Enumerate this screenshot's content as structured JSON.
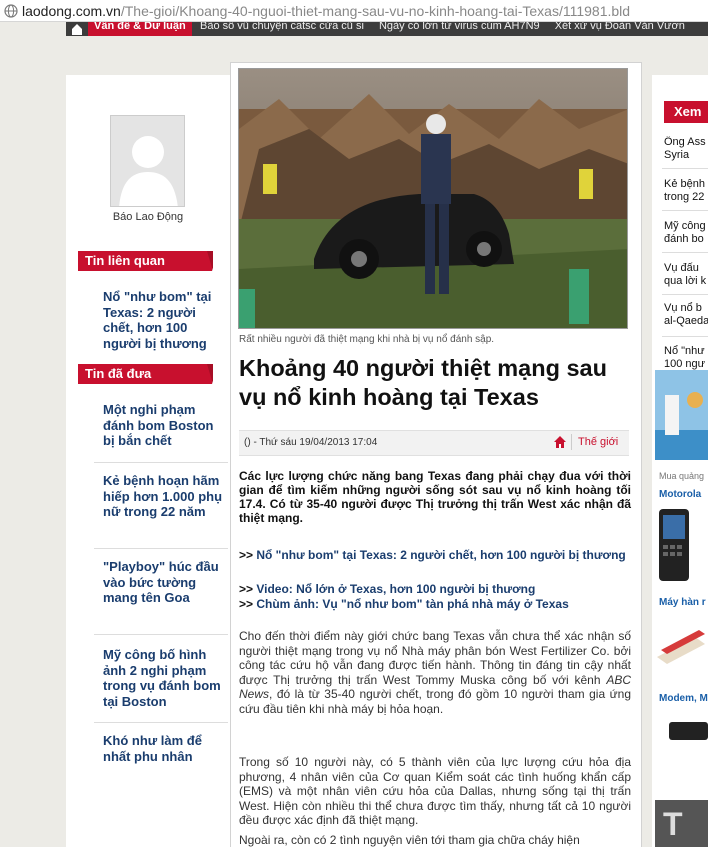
{
  "browser": {
    "url_host": "laodong.com.vn",
    "url_path": "/The-gioi/Khoang-40-nguoi-thiet-mang-sau-vu-no-kinh-hoang-tai-Texas/111981.bld"
  },
  "nav": {
    "active_label": "Vấn đề & Dư luận",
    "links": [
      "Bão số vũ chuyện catsc cửa cũ si",
      "Ngày có lớn từ virus cúm AH7N9",
      "Xét xử vụ Đoàn Văn Vươn"
    ]
  },
  "left": {
    "avatar_label": "Báo Lao Động",
    "related_heading": "Tin liên quan",
    "related": [
      "Nổ \"như bom\" tại Texas: 2 người chết, hơn 100 người bị thương"
    ],
    "posted_heading": "Tin đã đưa",
    "posted": [
      "Một nghi phạm đánh bom Boston bị bắn chết",
      "Kẻ bệnh hoạn hãm hiếp hơn 1.000 phụ nữ trong 22 năm",
      "\"Playboy\" húc đầu vào bức tường mang tên Goa",
      "Mỹ công bố hình ảnh 2 nghi phạm trong vụ đánh bom tại Boston",
      "Khó như làm để nhất phu nhân"
    ]
  },
  "article": {
    "caption": "Rất nhiều người đã thiệt mạng khi nhà bị vụ nổ đánh sập.",
    "headline": "Khoảng 40 người thiệt mạng sau vụ nổ kinh hoàng tại Texas",
    "meta_date": "() - Thứ sáu 19/04/2013 17:04",
    "category": "Thế giới",
    "lead": "Các lực lượng chức năng bang Texas đang phải chạy đua với thời gian để tìm kiếm những người sống sót sau vụ nổ kinh hoàng tối 17.4. Có từ 35-40 người được Thị trưởng thị trấn West xác nhận đã thiệt mạng.",
    "related": [
      {
        "prefix": ">>",
        "text": " Nổ \"như bom\" tại Texas: 2 người chết, hơn 100 người bị thương"
      },
      {
        "prefix": ">>",
        "text": " Video: Nổ lớn ở Texas, hơn 100 người bị thương"
      },
      {
        "prefix": ">>",
        "text": " Chùm ảnh: Vụ \"nổ như bom\" tàn phá nhà máy ở Texas"
      }
    ],
    "para1_a": "Cho đến thời điểm này giới chức bang Texas vẫn chưa thể xác nhận số người thiệt mạng trong vụ nổ Nhà máy phân bón West Fertilizer Co. bởi công tác cứu hộ vẫn đang được tiến hành. Thông tin đáng tin cậy nhất được Thị trưởng thị trấn West Tommy Muska công bố với kênh ",
    "para1_em": "ABC News",
    "para1_b": ", đó là từ 35-40 người chết, trong đó gồm 10 người tham gia ứng cứu đầu tiên khi nhà máy bị hỏa hoạn.",
    "para2": "Trong số 10 người này, có 5 thành viên của lực lượng cứu hỏa địa phương, 4 nhân viên của Cơ quan Kiểm soát các tình huống khẩn cấp (EMS) và một nhân viên cứu hỏa của Dallas, nhưng sống tại thị trấn West. Hiện còn nhiều thi thể chưa được tìm thấy, nhưng tất cả 10 người đều được xác định đã thiệt mạng.",
    "para3": "Ngoài ra, còn có 2 tình nguyện viên tới tham gia chữa cháy hiện"
  },
  "right": {
    "heading": "Xem",
    "items": [
      [
        "Ông Ass",
        "Syria"
      ],
      [
        "Kẻ bệnh",
        "trong 22"
      ],
      [
        "Mỹ công",
        "đánh bo"
      ],
      [
        "Vụ đấu",
        "qua lời k"
      ],
      [
        "Vụ nổ b",
        "al-Qaeda"
      ],
      [
        "Nổ \"như",
        "100 ngư"
      ]
    ],
    "ad_tag": "Mua quảng",
    "ad1": "Motorola",
    "ad2": "Máy hàn r",
    "ad3": "Modem, M",
    "ad_bottom": "T"
  }
}
